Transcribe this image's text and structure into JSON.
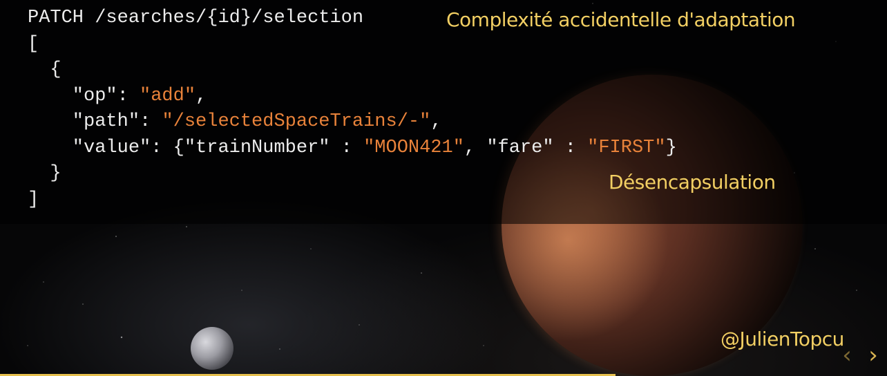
{
  "code": {
    "line1": "PATCH /searches/{id}/selection",
    "line2": "[",
    "line3": "  {",
    "op_key": "    \"op\": ",
    "op_value": "\"add\"",
    "op_end": ",",
    "path_key": "    \"path\": ",
    "path_value": "\"/selectedSpaceTrains/-\"",
    "path_end": ",",
    "value_key": "    \"value\": {\"trainNumber\" : ",
    "train_value": "\"MOON421\"",
    "fare_key": ", \"fare\" : ",
    "fare_value": "\"FIRST\"",
    "value_end": "}",
    "line7": "  }",
    "line8": "]"
  },
  "annotations": {
    "accidental_complexity": "Complexité accidentelle d'adaptation",
    "decapsulation": "Désencapsulation"
  },
  "footer": {
    "handle": "@JulienTopcu"
  },
  "navigation": {
    "prev_icon": "chevron-left-icon",
    "next_icon": "chevron-right-icon",
    "prev_glyph": "‹",
    "next_glyph": "›"
  },
  "progress": {
    "fraction": 0.694
  },
  "colors": {
    "code_text": "#ececec",
    "string_literal": "#e8823a",
    "annotation": "#f2cf63",
    "progress_bar": "#e6c04e"
  }
}
